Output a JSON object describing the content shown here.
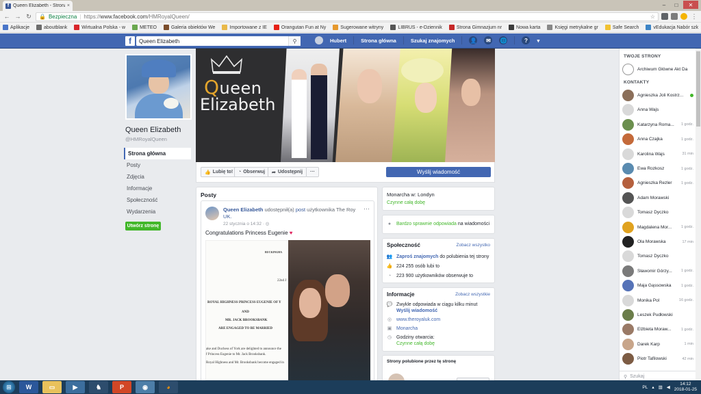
{
  "browser": {
    "tab_title": "Queen Elizabeth - Strona",
    "tab_close": "×",
    "secure_label": "Bezpieczna",
    "url_scheme": "https://",
    "url_host": "www.facebook.com",
    "url_path": "/HMRoyalQueen/",
    "bookmarks": [
      {
        "label": "Aplikacje",
        "color": "#4a76c9"
      },
      {
        "label": "aboutblank",
        "color": "#6d6d6d"
      },
      {
        "label": "Wirtualna Polska - w",
        "color": "#d8262b"
      },
      {
        "label": "METEO",
        "color": "#6aa84f"
      },
      {
        "label": "Galeria obiektów We",
        "color": "#7b4d2b"
      },
      {
        "label": "Importowane z IE",
        "color": "#e9b949"
      },
      {
        "label": "Orangutan Fun at Ny",
        "color": "#e62117"
      },
      {
        "label": "Sugerowane witryny",
        "color": "#e6992e"
      },
      {
        "label": "LIBRUS - e-Dziennik",
        "color": "#555555"
      },
      {
        "label": "Strona Gimnazjum nr",
        "color": "#c62828"
      },
      {
        "label": "Nowa karta",
        "color": "#3b3b3b"
      },
      {
        "label": "Księgi metrykalne gr",
        "color": "#888888"
      },
      {
        "label": "Safe Search",
        "color": "#f1c232"
      },
      {
        "label": "vEdukacja Nabór szk",
        "color": "#3d85c6"
      }
    ]
  },
  "fb": {
    "search_value": "Queen Elizabeth",
    "user_name": "Hubert",
    "nav_home": "Strona główna",
    "nav_friends": "Szukaj znajomych"
  },
  "page": {
    "name": "Queen Elizabeth",
    "handle": "@HMRoyalQueen",
    "left_nav": [
      "Strona główna",
      "Posty",
      "Zdjęcia",
      "Informacje",
      "Społeczność",
      "Wydarzenia"
    ],
    "create_page_label": "Utwórz stronę",
    "cover_text_1": "ueen",
    "cover_text_Q": "Q",
    "cover_text_2": "Elizabeth",
    "actions": {
      "like": "Lubię to!",
      "follow": "Obserwuj",
      "share": "Udostępnij",
      "more": "···",
      "send_message": "Wyślij wiadomość"
    }
  },
  "posts": {
    "header": "Posty",
    "post": {
      "author": "Queen Elizabeth",
      "shared_text": " udostępnił(a) ",
      "shared_link": "post",
      "shared_rest": " użytkownika The Roy",
      "line2": "UK.",
      "date": "22 stycznia o 14:32 · ",
      "text": "Congratulations Princess Eugenie ",
      "heart": "♥",
      "letter": {
        "l1": "BUCKINGHA",
        "l2": "22nd J",
        "l3": "ROYAL HIGHNESS PRINCESS EUGENIE OF Y",
        "l4": "AND",
        "l5": "MR. JACK BROOKSBANK",
        "l6": "ARE ENGAGED TO BE MARRIED",
        "l7": "ake and Duchess of York are delighted to announce the",
        "l8": "f Princess Eugenie to Mr. Jack Brooksbank.",
        "l9": "Royal Highness and Mr. Brooksbank become engaged in"
      }
    }
  },
  "info": {
    "category": "Monarcha w: Londyn",
    "open_status": "Czynne całą dobę",
    "responsive": "Bardzo sprawnie odpowiada",
    "responsive_rest": " na wiadomości",
    "community_header": "Społeczność",
    "see_all": "Zobacz wszystko",
    "invite_link": "Zaproś znajomych",
    "invite_rest": " do polubienia tej strony",
    "likes": "224 255 osób lubi to",
    "followers": "223 900 użytkowników obserwuje to",
    "info_header": "Informacje",
    "see_all_2": "Zobacz wszystkie",
    "reply_time": "Zwykle odpowiada w ciągu kilku minut",
    "send_msg_link": "Wyślij wiadomość",
    "website": "www.theroyaluk.com",
    "category2": "Monarcha",
    "hours_label": "Godziny otwarcia:",
    "hours_value": "Czynne całą dobę",
    "liked_pages_header": "Strony polubione przez tę stronę"
  },
  "chat": {
    "pages_header": "TWOJE STRONY",
    "page_item": "Archiwum Główne Akt Da",
    "contacts_header": "KONTAKTY",
    "contacts": [
      {
        "name": "Agnieszka Joli Kostrz...",
        "time": "",
        "online": true,
        "color": "#8b6f5a"
      },
      {
        "name": "Anna Wajs",
        "time": "",
        "online": false,
        "color": "#d9d9d9"
      },
      {
        "name": "Katarzyna Roma...",
        "time": "1 godz.",
        "online": false,
        "color": "#6b8f4e"
      },
      {
        "name": "Anna Czajka",
        "time": "1 godz.",
        "online": false,
        "color": "#c46a3a"
      },
      {
        "name": "Karolina Wajs",
        "time": "31 min",
        "online": false,
        "color": "#d9d9d9"
      },
      {
        "name": "Ewa Rozkosz",
        "time": "1 godz.",
        "online": false,
        "color": "#5a8bb0"
      },
      {
        "name": "Agnieszka Rezler",
        "time": "1 godz.",
        "online": false,
        "color": "#b5603e"
      },
      {
        "name": "Adam Morawski",
        "time": "",
        "online": false,
        "color": "#555555"
      },
      {
        "name": "Tomasz Dyczko",
        "time": "",
        "online": false,
        "color": "#d9d9d9"
      },
      {
        "name": "Magdalena Mor...",
        "time": "1 godz.",
        "online": false,
        "color": "#e0a21f"
      },
      {
        "name": "Ola Morawska",
        "time": "17 min",
        "online": false,
        "color": "#222222"
      },
      {
        "name": "Tomasz Dyczko",
        "time": "",
        "online": false,
        "color": "#d9d9d9"
      },
      {
        "name": "Sławomir Górzy...",
        "time": "1 godz.",
        "online": false,
        "color": "#7a7a7a"
      },
      {
        "name": "Maja Gąssowska",
        "time": "1 godz.",
        "online": false,
        "color": "#5673b8"
      },
      {
        "name": "Monika Pol",
        "time": "16 godz.",
        "online": false,
        "color": "#d9d9d9"
      },
      {
        "name": "Leszek Pudłowski",
        "time": "",
        "online": false,
        "color": "#6b7d4a"
      },
      {
        "name": "Elżbieta Moraw...",
        "time": "1 godz.",
        "online": false,
        "color": "#9a7a66"
      },
      {
        "name": "Darek Karp",
        "time": "1 min",
        "online": false,
        "color": "#c8a58a"
      },
      {
        "name": "Piotr Tafilowski",
        "time": "42 min",
        "online": false,
        "color": "#7d5c44"
      }
    ],
    "search_placeholder": "Szukaj"
  },
  "taskbar": {
    "lang": "PL",
    "time": "14:12",
    "date": "2018-01-25"
  }
}
